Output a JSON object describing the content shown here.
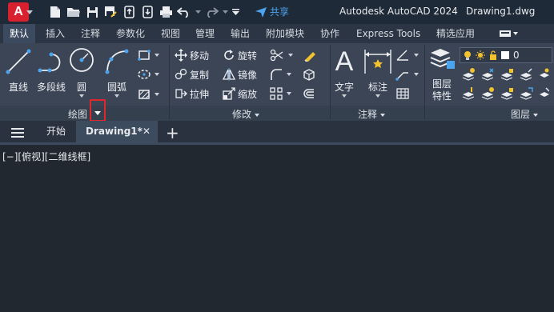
{
  "titlebar": {
    "app_title": "Autodesk AutoCAD 2024",
    "document": "Drawing1.dwg",
    "logo_letter": "A",
    "share_label": "共享",
    "quick_access": [
      "new-icon",
      "open-icon",
      "save-icon",
      "save-as-icon",
      "upload-icon",
      "download-icon",
      "plot-icon",
      "undo-icon",
      "redo-icon",
      "customize-icon"
    ]
  },
  "ribbon_tabs": [
    {
      "label": "默认",
      "active": true
    },
    {
      "label": "插入"
    },
    {
      "label": "注释"
    },
    {
      "label": "参数化"
    },
    {
      "label": "视图"
    },
    {
      "label": "管理"
    },
    {
      "label": "输出"
    },
    {
      "label": "附加模块"
    },
    {
      "label": "协作"
    },
    {
      "label": "Express Tools"
    },
    {
      "label": "精选应用"
    }
  ],
  "panels": {
    "draw": {
      "title": "绘图",
      "tools": {
        "line": "直线",
        "polyline": "多段线",
        "circle": "圆",
        "arc": "圆弧"
      }
    },
    "modify": {
      "title": "修改",
      "tools": {
        "move": "移动",
        "rotate": "旋转",
        "copy": "复制",
        "mirror": "镜像",
        "stretch": "拉伸",
        "scale": "缩放"
      }
    },
    "annotation": {
      "title": "注释",
      "tools": {
        "text": "文字",
        "dimension": "标注"
      }
    },
    "layers": {
      "title": "图层",
      "layer_properties_line1": "图层",
      "layer_properties_line2": "特性",
      "current_layer": "0"
    }
  },
  "doc_tabs": {
    "start": "开始",
    "current": "Drawing1*",
    "close": "✕",
    "new": "+"
  },
  "viewport": {
    "label": "[−][俯视][二维线框]"
  },
  "colors": {
    "accent_share": "#4ca3ee",
    "logo_red": "#d8202f",
    "highlight_red": "#e3262b",
    "icon_yellow": "#f2c12e"
  }
}
